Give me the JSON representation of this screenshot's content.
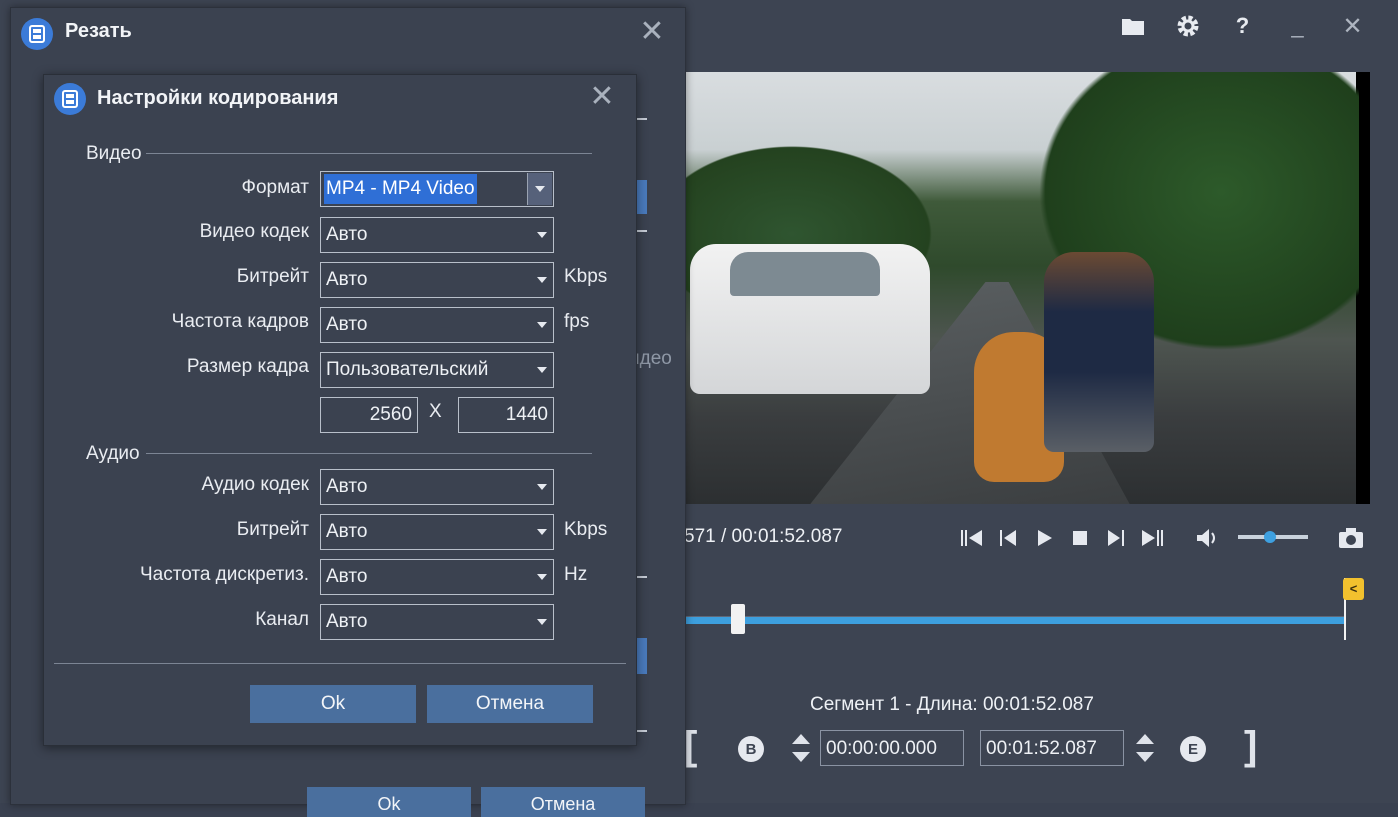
{
  "app": {
    "toolbar": {
      "folder_icon": "folder-icon",
      "settings_icon": "gear-icon",
      "help_label": "?",
      "minimize_label": "_",
      "close_label": "✕"
    },
    "player": {
      "time_readout": "571 / 00:01:52.087",
      "end_marker": "<"
    },
    "segment": {
      "label": "Сегмент 1 - Длина: 00:01:52.087",
      "start_bracket": "[",
      "end_bracket": "]",
      "begin_button": "B",
      "end_button": "E",
      "start_time": "00:00:00.000",
      "end_time": "00:01:52.087"
    }
  },
  "cut_dialog": {
    "title": "Резать",
    "close_label": "✕",
    "underlay_text": "идео",
    "ok_label": "Ok",
    "cancel_label": "Отмена"
  },
  "encoding_dialog": {
    "title": "Настройки кодирования",
    "close_label": "✕",
    "video": {
      "section": "Видео",
      "format_label": "Формат",
      "format_value": "MP4 - MP4 Video",
      "codec_label": "Видео кодек",
      "codec_value": "Авто",
      "bitrate_label": "Битрейт",
      "bitrate_value": "Авто",
      "bitrate_unit": "Kbps",
      "framerate_label": "Частота кадров",
      "framerate_value": "Авто",
      "framerate_unit": "fps",
      "framesize_label": "Размер кадра",
      "framesize_value": "Пользовательский",
      "width": "2560",
      "times": "X",
      "height": "1440"
    },
    "audio": {
      "section": "Аудио",
      "codec_label": "Аудио кодек",
      "codec_value": "Авто",
      "bitrate_label": "Битрейт",
      "bitrate_value": "Авто",
      "bitrate_unit": "Kbps",
      "samplerate_label": "Частота дискретиз.",
      "samplerate_value": "Авто",
      "samplerate_unit": "Hz",
      "channel_label": "Канал",
      "channel_value": "Авто"
    },
    "ok_label": "Ok",
    "cancel_label": "Отмена"
  }
}
